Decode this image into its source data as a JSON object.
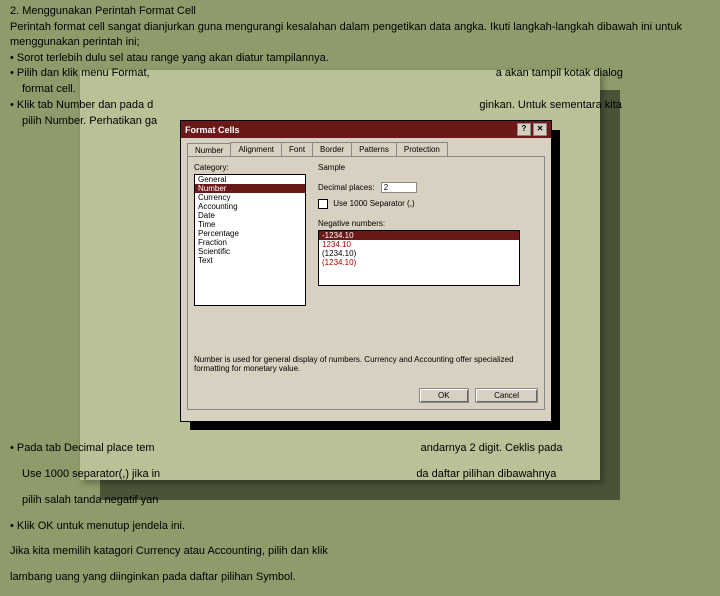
{
  "text": {
    "heading": "2. Menggunakan Perintah Format Cell",
    "p1": "Perintah format cell sangat dianjurkan guna mengurangi kesalahan dalam pengetikan data angka. Ikuti langkah-langkah dibawah ini untuk menggunakan perintah ini;",
    "b1": "• Sorot terlebih dulu sel atau range yang akan diatur tampilannya.",
    "b2a": "• Pilih dan klik menu Format,",
    "b2b": "a akan tampil kotak dialog",
    "b2c": "format cell.",
    "b3a": "• Klik tab Number dan pada d",
    "b3b": "ginkan. Untuk sementara kita",
    "b3c": "pilih Number. Perhatikan ga",
    "p2a": "• Pada tab Decimal place tem",
    "p2b": "andarnya 2 digit. Ceklis pada",
    "p2c": "Use 1000 separator(,) jika in",
    "p2d": "da daftar pilihan dibawahnya",
    "p2e": "pilih salah tanda negatif yan",
    "p3": "• Klik OK untuk menutup jendela ini.",
    "p4": "Jika kita memilih katagori Currency atau Accounting, pilih dan klik",
    "p5": "lambang uang yang diinginkan pada daftar pilihan Symbol."
  },
  "dialog": {
    "title": "Format Cells",
    "tabs": [
      "Number",
      "Alignment",
      "Font",
      "Border",
      "Patterns",
      "Protection"
    ],
    "category_label": "Category:",
    "categories": [
      "General",
      "Number",
      "Currency",
      "Accounting",
      "Date",
      "Time",
      "Percentage",
      "Fraction",
      "Scientific",
      "Text"
    ],
    "selected_category": "Number",
    "sample_label": "Sample",
    "decimal_label": "Decimal places:",
    "decimal_value": "2",
    "separator_label": "Use 1000 Separator (,)",
    "negative_label": "Negative numbers:",
    "negative_options": [
      "-1234.10",
      "1234.10",
      "(1234.10)",
      "(1234.10)"
    ],
    "description": "Number is used for general display of numbers. Currency and Accounting offer specialized formatting for monetary value.",
    "ok": "OK",
    "cancel": "Cancel",
    "close": "✕",
    "help": "?"
  }
}
